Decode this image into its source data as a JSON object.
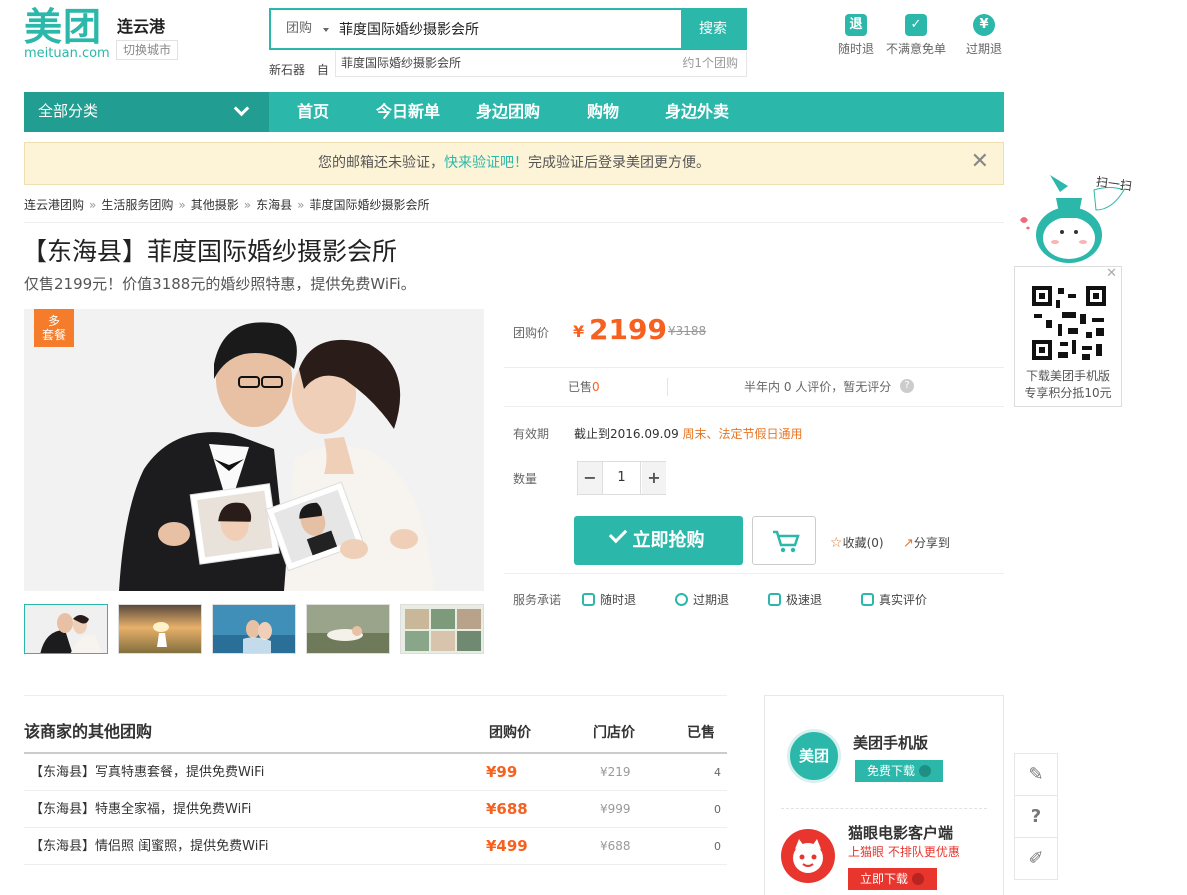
{
  "header": {
    "logo_cn": "美团",
    "logo_en": "meituan.com",
    "city": "连云港",
    "switch_city": "切换城市",
    "search": {
      "category": "团购",
      "query": "菲度国际婚纱摄影会所",
      "button": "搜索",
      "suggestion": "菲度国际婚纱摄影会所",
      "suggestion_count": "约1个团购"
    },
    "hot_words": "新石器",
    "hot_words2": "自",
    "promises": [
      {
        "icon": "退",
        "label": "随时退"
      },
      {
        "icon": "✓",
        "label": "不满意免单"
      },
      {
        "icon": "¥",
        "label": "过期退"
      }
    ]
  },
  "nav": {
    "all": "全部分类",
    "items": [
      "首页",
      "今日新单",
      "身边团购",
      "购物",
      "身边外卖"
    ]
  },
  "notice": {
    "pre": "您的邮箱还未验证，",
    "link": "快来验证吧！",
    "post": "完成验证后登录美团更方便。",
    "close": "✕"
  },
  "breadcrumbs": [
    "连云港团购",
    "生活服务团购",
    "其他摄影",
    "东海县",
    "菲度国际婚纱摄影会所"
  ],
  "breadcrumb_sep": "»",
  "deal": {
    "title": "【东海县】菲度国际婚纱摄影会所",
    "subtitle": "仅售2199元！价值3188元的婚纱照特惠，提供免费WiFi。",
    "badge_l1": "多",
    "badge_l2": "套餐",
    "price_label": "团购价",
    "currency": "¥",
    "price": "2199",
    "original_price": "¥3188",
    "sold_label": "已售",
    "sold_count": "0",
    "reviews": "半年内 0 人评价，暂无评分",
    "help": "?",
    "valid_label": "有效期",
    "valid_until": "截止到2016.09.09",
    "valid_note": "周末、法定节假日通用",
    "qty_label": "数量",
    "qty_minus": "−",
    "qty_value": "1",
    "qty_plus": "+",
    "buy_button": "立即抢购",
    "favorite": "收藏(0)",
    "share": "分享到",
    "service_label": "服务承诺",
    "services": [
      "随时退",
      "过期退",
      "极速退",
      "真实评价"
    ]
  },
  "other_deals": {
    "title": "该商家的其他团购",
    "headers": [
      "团购价",
      "门店价",
      "已售"
    ],
    "rows": [
      {
        "name": "【东海县】写真特惠套餐，提供免费WiFi",
        "price": "¥99",
        "orig": "¥219",
        "sold": "4"
      },
      {
        "name": "【东海县】特惠全家福，提供免费WiFi",
        "price": "¥688",
        "orig": "¥999",
        "sold": "0"
      },
      {
        "name": "【东海县】情侣照 闺蜜照，提供免费WiFi",
        "price": "¥499",
        "orig": "¥688",
        "sold": "0"
      }
    ]
  },
  "apps": {
    "meituan": {
      "logo": "美团",
      "name": "美团手机版",
      "button": "免费下载"
    },
    "maoyan": {
      "name": "猫眼电影客户端",
      "slogan": "上猫眼 不排队更优惠",
      "button": "立即下载"
    }
  },
  "qr": {
    "mascot_text": "扫一扫",
    "line1": "下载美团手机版",
    "line2": "专享积分抵10元",
    "close": "✕"
  },
  "colors": {
    "accent": "#2bb8aa",
    "price": "#f76120",
    "notice_bg": "#fdf4d8"
  }
}
